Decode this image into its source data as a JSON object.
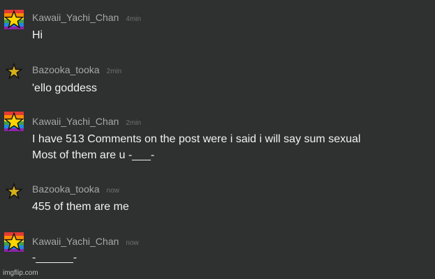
{
  "messages": [
    {
      "user": "Kawaii_Yachi_Chan",
      "time": "4min",
      "avatar": "rainbow-star-avatar",
      "lines": [
        "Hi"
      ]
    },
    {
      "user": "Bazooka_tooka",
      "time": "2min",
      "avatar": "small-star-avatar",
      "lines": [
        "'ello goddess"
      ]
    },
    {
      "user": "Kawaii_Yachi_Chan",
      "time": "2min",
      "avatar": "rainbow-star-avatar",
      "lines": [
        "I have 513 Comments on the post were i said i will say sum sexual",
        "Most of them are u -___-"
      ]
    },
    {
      "user": "Bazooka_tooka",
      "time": "now",
      "avatar": "small-star-avatar",
      "lines": [
        "455 of them are me"
      ]
    },
    {
      "user": "Kawaii_Yachi_Chan",
      "time": "now",
      "avatar": "rainbow-star-avatar",
      "lines": [
        "-______-"
      ]
    }
  ],
  "watermark": "imgflip.com",
  "colors": {
    "background": "#2f3030",
    "username": "#a7a8a8",
    "timestamp": "#707171",
    "message_text": "#f2f2f2"
  }
}
